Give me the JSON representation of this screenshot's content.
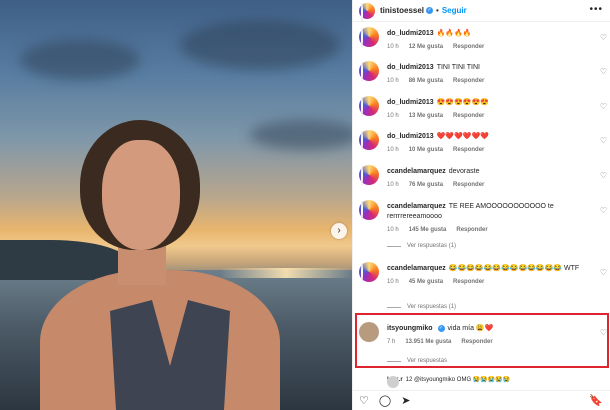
{
  "header": {
    "username": "tinistoessel",
    "separator": "•",
    "follow_label": "Seguir",
    "more_icon": "more-horizontal-icon"
  },
  "photo": {
    "next_icon": "chevron-right-icon",
    "next_glyph": "›"
  },
  "comments": [
    {
      "user": "do_ludmi2013",
      "text": "🔥🔥🔥🔥",
      "time": "10 h",
      "likes": "12 Me gusta",
      "reply": "Responder"
    },
    {
      "user": "do_ludmi2013",
      "text": "TINI TINI TINI",
      "time": "10 h",
      "likes": "86 Me gusta",
      "reply": "Responder"
    },
    {
      "user": "do_ludmi2013",
      "text": "😍😍😍😍😍😍",
      "time": "10 h",
      "likes": "13 Me gusta",
      "reply": "Responder"
    },
    {
      "user": "do_ludmi2013",
      "text": "❤️❤️❤️❤️❤️❤️",
      "time": "10 h",
      "likes": "10 Me gusta",
      "reply": "Responder"
    },
    {
      "user": "ccandelamarquez",
      "text": "devoraste",
      "time": "10 h",
      "likes": "76 Me gusta",
      "reply": "Responder"
    },
    {
      "user": "ccandelamarquez",
      "text": "TE REE AMOOOOOOOOOOO te rerrrrereeamoooo",
      "time": "10 h",
      "likes": "145 Me gusta",
      "reply": "Responder",
      "view_replies": "Ver respuestas (1)"
    },
    {
      "user": "ccandelamarquez",
      "text": "😂😂😂😂😂😂😂😂😂😂😂😂😂 WTF",
      "time": "10 h",
      "likes": "45 Me gusta",
      "reply": "Responder",
      "view_replies": "Ver respuestas (1)"
    },
    {
      "user": "itsyoungmiko",
      "text": "vida mía 😩❤️",
      "time": "7 h",
      "likes": "13.951 Me gusta",
      "reply": "Responder",
      "view_replies": "Ver respuestas"
    },
    {
      "user": "lxpz.r",
      "text": "12 @itsyoungmiko OMG 😭😭😭😭😭"
    }
  ],
  "actions": {
    "like_glyph": "♡",
    "comment_glyph": "◯",
    "share_glyph": "➤",
    "save_glyph": "🔖"
  },
  "colors": {
    "accent": "#0095f6",
    "highlight": "#e0242f",
    "meta": "#737373"
  }
}
